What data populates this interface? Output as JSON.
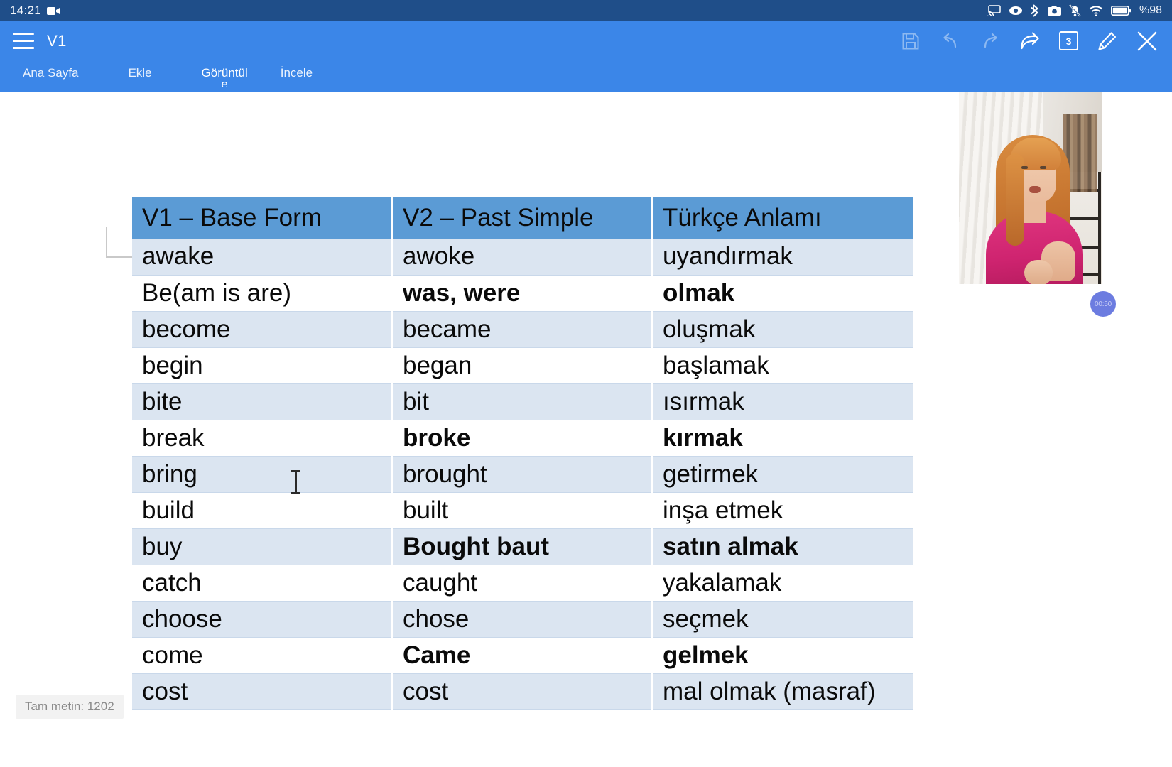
{
  "status_bar": {
    "time": "14:21",
    "left_icons": [
      "video-record-icon"
    ],
    "right_icons": [
      "screencast-icon",
      "eye-icon",
      "bluetooth-icon",
      "camera-icon",
      "notification-muted-icon",
      "wifi-icon",
      "battery-icon"
    ],
    "battery_text": "%98"
  },
  "app_bar": {
    "menu_icon": "hamburger-menu-icon",
    "document_title": "V1",
    "actions": [
      {
        "name": "save-button",
        "icon": "save-icon",
        "enabled": false
      },
      {
        "name": "undo-button",
        "icon": "undo-icon",
        "enabled": false
      },
      {
        "name": "redo-button",
        "icon": "redo-icon",
        "enabled": false
      },
      {
        "name": "share-button",
        "icon": "share-icon",
        "enabled": true
      },
      {
        "name": "page-count-button",
        "icon": "page-count-icon",
        "enabled": true
      },
      {
        "name": "edit-button",
        "icon": "pen-icon",
        "enabled": true
      },
      {
        "name": "close-button",
        "icon": "close-icon",
        "enabled": true
      }
    ],
    "page_count": "3",
    "tabs": [
      {
        "label": "Ana Sayfa",
        "active": false
      },
      {
        "label": "Ekle",
        "active": false
      },
      {
        "label": "Görüntül",
        "label_overflow": "e",
        "active": true
      },
      {
        "label": "İncele",
        "active": false
      }
    ]
  },
  "document": {
    "word_count_label": "Tam metin: 1202",
    "table": {
      "headers": [
        "V1 – Base Form",
        "V2 – Past Simple",
        "Türkçe Anlamı"
      ],
      "rows": [
        {
          "v1": "awake",
          "v2": "awoke",
          "tr": "uyandırmak",
          "shade": true,
          "bold": false
        },
        {
          "v1": "Be(am is are)",
          "v2": "was, were",
          "tr": "olmak",
          "shade": false,
          "bold": true
        },
        {
          "v1": "become",
          "v2": "became",
          "tr": "oluşmak",
          "shade": true,
          "bold": false
        },
        {
          "v1": "begin",
          "v2": "began",
          "tr": "başlamak",
          "shade": false,
          "bold": false
        },
        {
          "v1": "bite",
          "v2": "bit",
          "tr": "ısırmak",
          "shade": true,
          "bold": false
        },
        {
          "v1": "break",
          "v2": "broke",
          "tr": "kırmak",
          "shade": false,
          "bold": true
        },
        {
          "v1": "bring",
          "v2": "brought",
          "tr": "getirmek",
          "shade": true,
          "bold": false
        },
        {
          "v1": "build",
          "v2": "built",
          "tr": "inşa etmek",
          "shade": false,
          "bold": false
        },
        {
          "v1": "buy",
          "v2": "Bought baut",
          "tr": "satın almak",
          "shade": true,
          "bold": true
        },
        {
          "v1": "catch",
          "v2": "caught",
          "tr": "yakalamak",
          "shade": false,
          "bold": false
        },
        {
          "v1": "choose",
          "v2": "chose",
          "tr": "seçmek",
          "shade": true,
          "bold": false
        },
        {
          "v1": "come",
          "v2": "Came",
          "tr": "gelmek",
          "shade": false,
          "bold": true
        },
        {
          "v1": "cost",
          "v2": "cost",
          "tr": "mal olmak (masraf)",
          "shade": true,
          "bold": false
        }
      ]
    }
  },
  "video_overlay": {
    "name": "presenter-video",
    "timer_badge": "00:50"
  },
  "colors": {
    "status_bar_bg": "#1f4e89",
    "app_bar_bg": "#3b86e8",
    "table_header_bg": "#5b9bd5",
    "table_row_shade": "#dbe5f1",
    "table_row_plain": "#ffffff",
    "badge_bg": "#6c7ce0"
  }
}
